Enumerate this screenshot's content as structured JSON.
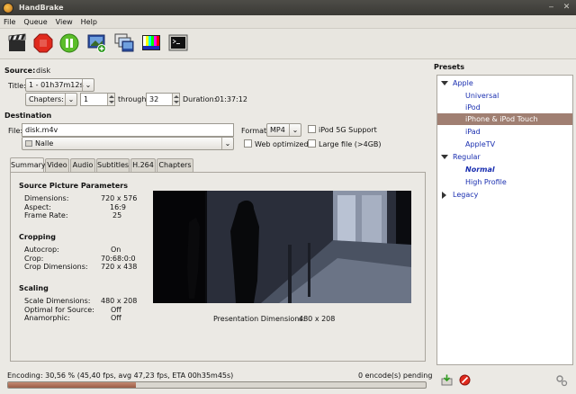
{
  "window": {
    "title": "HandBrake"
  },
  "menu": [
    "File",
    "Queue",
    "View",
    "Help"
  ],
  "source": {
    "label": "Source:",
    "value": "disk",
    "title_label": "Title:",
    "title_value": "1 - 01h37m12s",
    "chapters_mode": "Chapters:",
    "chapter_start": "1",
    "through_label": "through",
    "chapter_end": "32",
    "duration_label": "Duration:",
    "duration_value": "01:37:12"
  },
  "destination": {
    "label": "Destination",
    "file_label": "File:",
    "file_value": "disk.m4v",
    "folder_value": "Nalle",
    "format_label": "Format:",
    "format_value": "MP4",
    "ipod_label": "iPod 5G Support",
    "web_label": "Web optimized",
    "large_label": "Large file (>4GB)"
  },
  "tabs": [
    "Summary",
    "Video",
    "Audio",
    "Subtitles",
    "H.264",
    "Chapters"
  ],
  "summary": {
    "source_heading": "Source Picture Parameters",
    "dimensions_label": "Dimensions:",
    "dimensions_value": "720 x 576",
    "aspect_label": "Aspect:",
    "aspect_value": "16:9",
    "framerate_label": "Frame Rate:",
    "framerate_value": "25",
    "cropping_heading": "Cropping",
    "autocrop_label": "Autocrop:",
    "autocrop_value": "On",
    "crop_label": "Crop:",
    "crop_value": "70:68:0:0",
    "cropdim_label": "Crop Dimensions:",
    "cropdim_value": "720 x 438",
    "scaling_heading": "Scaling",
    "scaledim_label": "Scale Dimensions:",
    "scaledim_value": "480 x 208",
    "optimal_label": "Optimal for Source:",
    "optimal_value": "Off",
    "anamorphic_label": "Anamorphic:",
    "anamorphic_value": "Off",
    "presentation_label": "Presentation Dimensions:",
    "presentation_value": "480 x 208"
  },
  "status": {
    "encoding": "Encoding: 30,56 % (45,40 fps, avg 47,23 fps, ETA 00h35m45s)",
    "pending": "0 encode(s) pending",
    "progress": 0.3056
  },
  "presets": {
    "heading": "Presets",
    "apple": "Apple",
    "universal": "Universal",
    "ipod": "iPod",
    "iphone": "iPhone & iPod Touch",
    "ipad": "iPad",
    "appletv": "AppleTV",
    "regular": "Regular",
    "normal": "Normal",
    "highprofile": "High Profile",
    "legacy": "Legacy"
  },
  "colors": {
    "accent": "#a07f72",
    "progress": "#9b5c46",
    "link": "#1a2fb0"
  }
}
